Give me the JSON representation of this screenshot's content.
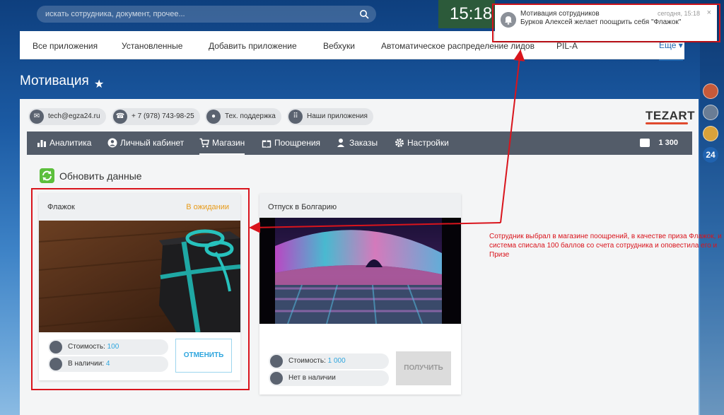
{
  "search": {
    "placeholder": "искать сотрудника, документ, прочее..."
  },
  "clock": "15:18",
  "rail": {
    "badge": "24"
  },
  "app_tabs": [
    "Все приложения",
    "Установленные",
    "Добавить приложение",
    "Вебхуки",
    "Автоматическое распределение лидов",
    "PIL-A",
    "Еще ▾"
  ],
  "page": {
    "title": "Мотивация"
  },
  "contacts": [
    {
      "label": "tech@egza24.ru",
      "icon": "mail-icon"
    },
    {
      "label": "+ 7 (978) 743-98-25",
      "icon": "phone-icon"
    },
    {
      "label": "Тех. поддержка",
      "icon": "support-icon"
    },
    {
      "label": "Наши приложения",
      "icon": "apps-grid-icon"
    }
  ],
  "logo": "TEZART",
  "nav": [
    {
      "label": "Аналитика",
      "icon": "chart-icon"
    },
    {
      "label": "Личный кабинет",
      "icon": "user-icon"
    },
    {
      "label": "Магазин",
      "icon": "cart-icon",
      "active": true
    },
    {
      "label": "Поощрения",
      "icon": "gift-icon"
    },
    {
      "label": "Заказы",
      "icon": "orders-icon"
    },
    {
      "label": "Настройки",
      "icon": "gear-icon"
    }
  ],
  "balance": "1 300",
  "refresh_label": "Обновить данные",
  "cards": [
    {
      "title": "Флажок",
      "status": "В ожидании",
      "cost_label": "Стоимость:",
      "cost": "100",
      "stock_label": "В наличии:",
      "stock": "4",
      "button": "ОТМЕНИТЬ"
    },
    {
      "title": "Отпуск в Болгарию",
      "cost_label": "Стоимость:",
      "cost": "1 000",
      "stock_label": "Нет в наличии",
      "button": "ПОЛУЧИТЬ"
    }
  ],
  "annotation": "Сотрудник выбрал в магазине поощрений, в качестве приза Флажок, и система списала 100 баллов со счета сотрудника и оповестила его и Призе",
  "notification": {
    "title": "Мотивация сотрудников",
    "time": "сегодня, 15:18",
    "close": "×",
    "body": "Бурков Алексей желает поощрить себя \"Флажок\""
  },
  "colors": {
    "accent": "#2fa6de",
    "nav_bg": "#535c69",
    "pending": "#e89b1a",
    "annotation": "#d9141c"
  }
}
